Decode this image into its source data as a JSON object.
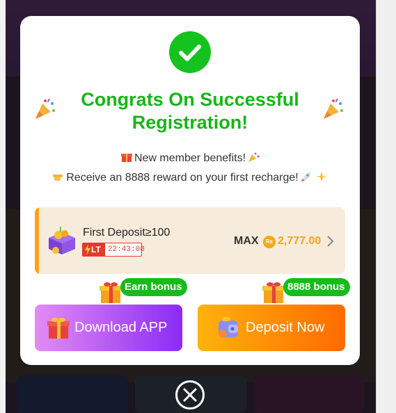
{
  "modal": {
    "title_line1": "Congrats On Successful",
    "title_line2": "Registration!",
    "benefit_line1": "New member benefits!",
    "benefit_line2": "Receive an 8888 reward on your first recharge!"
  },
  "deposit_card": {
    "title": "First Deposit≥100",
    "badge_label": "LT",
    "timer": "22:43:08",
    "max_label": "MAX",
    "currency_symbol": "Rs",
    "amount": "2,777.00"
  },
  "actions": {
    "download_badge": "Earn bonus",
    "download_label": "Download APP",
    "deposit_badge": "8888 bonus",
    "deposit_label": "Deposit Now"
  },
  "colors": {
    "success_green": "#16c21e",
    "accent_orange": "#ffa21a",
    "download_gradient": [
      "#e48bf7",
      "#8a2cf3"
    ],
    "deposit_gradient": [
      "#ffb20d",
      "#ff6b00"
    ],
    "timer_red": "#e23a2e"
  },
  "icons": [
    "checkmark-icon",
    "party-popper-icon",
    "gift-icon",
    "rocket-icon",
    "sparkles-icon",
    "pointing-hand-icon",
    "gift-box-icon",
    "lightning-icon",
    "coin-icon",
    "chevron-right-icon",
    "wallet-icon",
    "close-icon"
  ]
}
